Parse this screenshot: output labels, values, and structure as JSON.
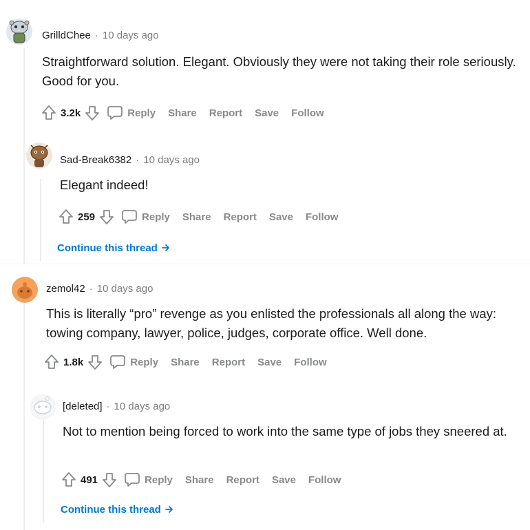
{
  "colors": {
    "link": "#0079d3",
    "muted": "#878a8c",
    "text": "#1c1c1c"
  },
  "comments": [
    {
      "username": "GrilldChee",
      "sep": "·",
      "time": "10 days ago",
      "body": "Straightforward solution. Elegant. Obviously they were not taking their role seriously. Good for you.",
      "score": "3.2k",
      "actions": {
        "reply": "Reply",
        "share": "Share",
        "report": "Report",
        "save": "Save",
        "follow": "Follow"
      },
      "avatar_icon": "snoo-avatar-icon"
    },
    {
      "username": "Sad-Break6382",
      "sep": "·",
      "time": "10 days ago",
      "body": "Elegant indeed!",
      "score": "259",
      "actions": {
        "reply": "Reply",
        "share": "Share",
        "report": "Report",
        "save": "Save",
        "follow": "Follow"
      },
      "continue": "Continue this thread",
      "avatar_icon": "snoo-avatar-icon"
    },
    {
      "username": "zemol42",
      "sep": "·",
      "time": "10 days ago",
      "body": "This is literally “pro” revenge as you enlisted the professionals all along the way: towing company, lawyer, police, judges, corporate office. Well done.",
      "score": "1.8k",
      "actions": {
        "reply": "Reply",
        "share": "Share",
        "report": "Report",
        "save": "Save",
        "follow": "Follow"
      },
      "avatar_icon": "default-avatar-icon"
    },
    {
      "username": "[deleted]",
      "sep": "·",
      "time": "10 days ago",
      "body": "Not to mention being forced to work into the same type of jobs they sneered at.",
      "score": "491",
      "actions": {
        "reply": "Reply",
        "share": "Share",
        "report": "Report",
        "save": "Save",
        "follow": "Follow"
      },
      "continue": "Continue this thread",
      "avatar_icon": "deleted-avatar-icon"
    }
  ]
}
